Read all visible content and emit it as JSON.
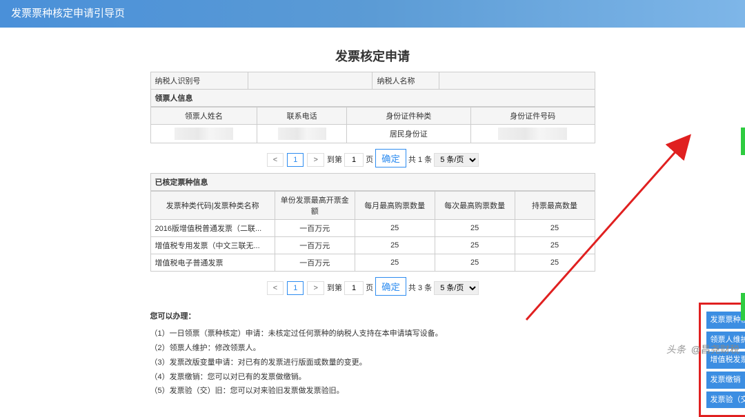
{
  "header": {
    "title": "发票票种核定申请引导页"
  },
  "page_title": "发票核定申请",
  "taxpayer": {
    "label_id": "纳税人识别号",
    "label_name": "纳税人名称",
    "value_id": "",
    "value_name": ""
  },
  "receiver_section": {
    "title": "领票人信息"
  },
  "receiver_headers": [
    "领票人姓名",
    "联系电话",
    "身份证件种类",
    "身份证件号码"
  ],
  "receiver_row": {
    "id_type": "居民身份证"
  },
  "approved_section": {
    "title": "已核定票种信息"
  },
  "approved_headers": [
    "发票种类代码|发票种类名称",
    "单份发票最高开票金额",
    "每月最高购票数量",
    "每次最高购票数量",
    "持票最高数量"
  ],
  "approved_rows": [
    {
      "c0": "2016版增值税普通发票（二联...",
      "c1": "一百万元",
      "c2": "25",
      "c3": "25",
      "c4": "25"
    },
    {
      "c0": "增值税专用发票（中文三联无...",
      "c1": "一百万元",
      "c2": "25",
      "c3": "25",
      "c4": "25"
    },
    {
      "c0": "增值税电子普通发票",
      "c1": "一百万元",
      "c2": "25",
      "c3": "25",
      "c4": "25"
    }
  ],
  "pager1": {
    "page": "1",
    "to": "到第",
    "page_unit": "页",
    "confirm": "确定",
    "total": "共 1 条",
    "per": "5 条/页"
  },
  "pager2": {
    "page": "1",
    "to": "到第",
    "page_unit": "页",
    "confirm": "确定",
    "total": "共 3 条",
    "per": "5 条/页"
  },
  "help": {
    "intro": "您可以办理：",
    "l1": "（1）一日领票（票种核定）申请：未核定过任何票种的纳税人支持在本申请填写设备。",
    "l2": "（2）领票人维护：修改领票人。",
    "l3": "（3）发票改版变量申请：对已有的发票进行版面或数量的变更。",
    "l4": "（4）发票缴销：您可以对已有的发票做缴销。",
    "l5": "（5）发票验（交）旧：您可以对来验旧发票做发票验旧。"
  },
  "actions": {
    "a1": "发票票种核定申请",
    "a2": "领票人维护",
    "a3": "增值税发票增版增量",
    "a4": "发票缴销",
    "a5": "发票验（交）旧"
  },
  "watermark": {
    "prefix": "头条",
    "text": " @昌尧财税"
  }
}
